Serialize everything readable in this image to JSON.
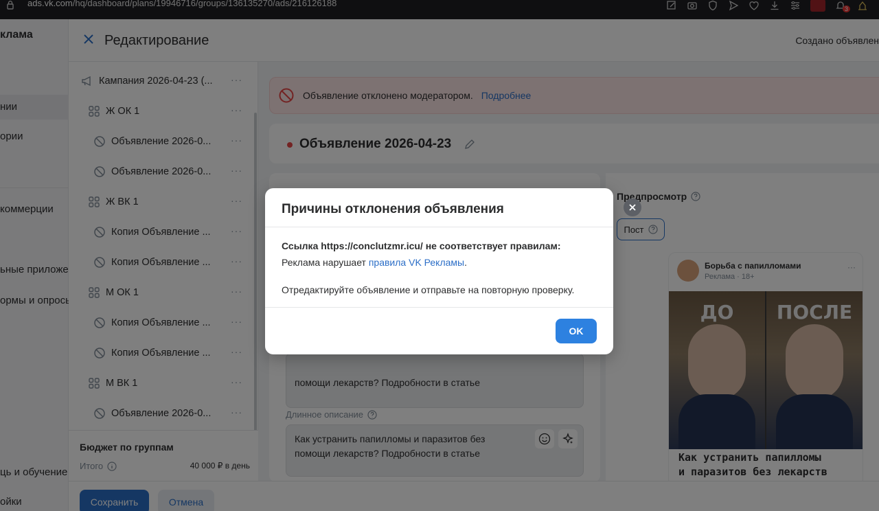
{
  "browser": {
    "url_domain": "ads.vk.com",
    "url_path": "/hq/dashboard/plans/19946716/groups/136135270/ads/216126188",
    "notifications_count": "3"
  },
  "leftnav": {
    "brand": "клама",
    "items": [
      {
        "label": "нии"
      },
      {
        "label": "ории"
      },
      {
        "label": "коммерции"
      },
      {
        "label": "ьные приложе"
      },
      {
        "label": "ормы и опросы"
      },
      {
        "label": "ць и обучение"
      },
      {
        "label": "ойки"
      }
    ]
  },
  "editor": {
    "title": "Редактирование",
    "created_text": "Создано объявлен"
  },
  "tree": {
    "items": [
      {
        "label": "Кампания 2026-04-23 (...",
        "icon": "megaphone-icon"
      },
      {
        "label": "Ж ОК 1",
        "icon": "group-icon"
      },
      {
        "label": "Объявление 2026-0...",
        "icon": "blocked-icon"
      },
      {
        "label": "Объявление 2026-0...",
        "icon": "blocked-icon"
      },
      {
        "label": "Ж ВК 1",
        "icon": "group-icon"
      },
      {
        "label": "Копия Объявление ...",
        "icon": "blocked-icon"
      },
      {
        "label": "Копия Объявление ...",
        "icon": "blocked-icon"
      },
      {
        "label": "М ОК 1",
        "icon": "group-icon"
      },
      {
        "label": "Копия Объявление ...",
        "icon": "blocked-icon"
      },
      {
        "label": "Копия Объявление ...",
        "icon": "blocked-icon"
      },
      {
        "label": "М ВК 1",
        "icon": "group-icon"
      },
      {
        "label": "Объявление 2026-0...",
        "icon": "blocked-icon"
      }
    ],
    "dots": "···"
  },
  "budget": {
    "title": "Бюджет по группам",
    "total_label": "Итого",
    "total_value": "40 000 ₽ в день"
  },
  "actions": {
    "save": "Сохранить",
    "cancel": "Отмена"
  },
  "alert": {
    "text": "Объявление отклонено модератором.",
    "link": "Подробнее"
  },
  "ad": {
    "name": "Объявление 2026-04-23"
  },
  "form": {
    "short_text": "помощи лекарств? Подробности в статье",
    "long_label": "Длинное описание",
    "long_text_1": "Как устранить папилломы и паразитов без",
    "long_text_2": "помощи лекарств? Подробности в статье"
  },
  "preview": {
    "title": "Предпросмотр",
    "chip": "Пост",
    "post_name": "Борьба с папилломами",
    "post_meta": "Реклама · 18+",
    "label_before": "ДО",
    "label_after": "ПОСЛЕ",
    "post_text_1": "Как устранить папилломы",
    "post_text_2": "и паразитов без лекарств"
  },
  "modal": {
    "title": "Причины отклонения объявления",
    "line1": "Ссылка https://conclutzmr.icu/ не соответствует правилам:",
    "line2_prefix": "Реклама нарушает ",
    "line2_link": "правила VK Рекламы",
    "line2_suffix": ".",
    "line3": "Отредактируйте объявление и отправьте на повторную проверку.",
    "ok": "OK"
  },
  "colors": {
    "accent": "#2d81e0",
    "primary_button": "#2b6ec7",
    "alert_bg": "#fbe4e4",
    "error_red": "#e64646"
  }
}
